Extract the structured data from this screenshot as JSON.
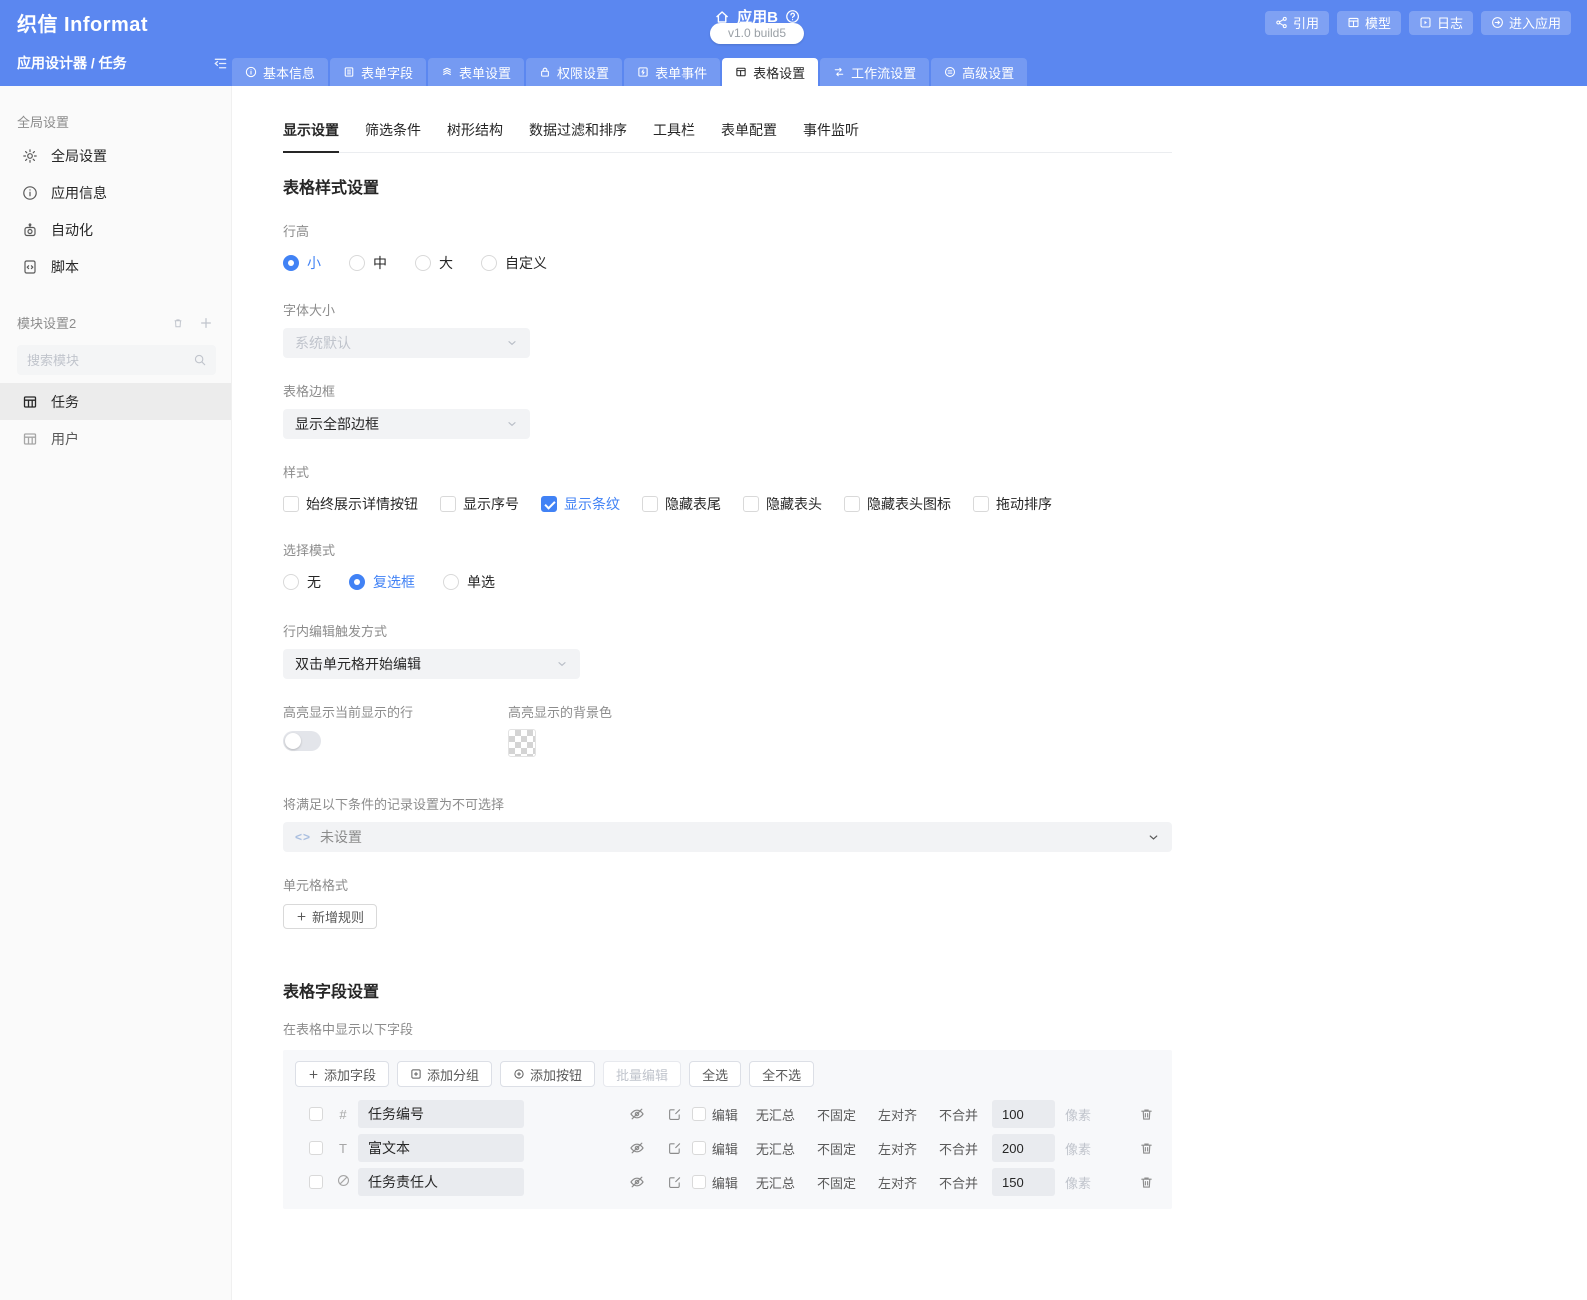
{
  "app": {
    "logo": "织信 Informat",
    "title": "应用B",
    "version": "v1.0 build5",
    "breadcrumb": "应用设计器 / 任务",
    "actions": [
      {
        "label": "引用"
      },
      {
        "label": "模型"
      },
      {
        "label": "日志"
      },
      {
        "label": "进入应用"
      }
    ]
  },
  "nav_tabs": [
    {
      "label": "基本信息"
    },
    {
      "label": "表单字段"
    },
    {
      "label": "表单设置"
    },
    {
      "label": "权限设置"
    },
    {
      "label": "表单事件"
    },
    {
      "label": "表格设置",
      "active": true
    },
    {
      "label": "工作流设置"
    },
    {
      "label": "高级设置"
    }
  ],
  "sidebar": {
    "global_section": "全局设置",
    "global_items": [
      {
        "label": "全局设置"
      },
      {
        "label": "应用信息"
      },
      {
        "label": "自动化"
      },
      {
        "label": "脚本"
      }
    ],
    "module_section": "模块设置2",
    "search_placeholder": "搜索模块",
    "modules": [
      {
        "label": "任务",
        "active": true
      },
      {
        "label": "用户",
        "active": false
      }
    ]
  },
  "subtabs": [
    {
      "label": "显示设置",
      "active": true
    },
    {
      "label": "筛选条件"
    },
    {
      "label": "树形结构"
    },
    {
      "label": "数据过滤和排序"
    },
    {
      "label": "工具栏"
    },
    {
      "label": "表单配置"
    },
    {
      "label": "事件监听"
    }
  ],
  "style": {
    "title": "表格样式设置",
    "row_height_label": "行高",
    "row_height_options": [
      {
        "label": "小"
      },
      {
        "label": "中"
      },
      {
        "label": "大"
      },
      {
        "label": "自定义"
      }
    ],
    "row_height_selected": "小",
    "font_size_label": "字体大小",
    "font_size_value": "系统默认",
    "border_label": "表格边框",
    "border_value": "显示全部边框",
    "style_label": "样式",
    "style_options": [
      {
        "label": "始终展示详情按钮"
      },
      {
        "label": "显示序号"
      },
      {
        "label": "显示条纹",
        "checked": true
      },
      {
        "label": "隐藏表尾"
      },
      {
        "label": "隐藏表头"
      },
      {
        "label": "隐藏表头图标"
      },
      {
        "label": "拖动排序"
      }
    ],
    "select_mode_label": "选择模式",
    "select_mode_options": [
      {
        "label": "无"
      },
      {
        "label": "复选框"
      },
      {
        "label": "单选"
      }
    ],
    "select_mode_selected": "复选框",
    "inline_edit_label": "行内编辑触发方式",
    "inline_edit_value": "双击单元格开始编辑",
    "highlight_row_label": "高亮显示当前显示的行",
    "highlight_row_enabled": false,
    "highlight_bg_label": "高亮显示的背景色",
    "disable_select_label": "将满足以下条件的记录设置为不可选择",
    "disable_select_value": "未设置",
    "cell_format_label": "单元格格式",
    "add_rule_label": "新增规则"
  },
  "fields": {
    "title": "表格字段设置",
    "subtitle": "在表格中显示以下字段",
    "toolbar": [
      {
        "label": "添加字段"
      },
      {
        "label": "添加分组"
      },
      {
        "label": "添加按钮"
      },
      {
        "label": "批量编辑",
        "disabled": true
      },
      {
        "label": "全选"
      },
      {
        "label": "全不选"
      }
    ],
    "row_labels": {
      "edit": "编辑",
      "summary": "无汇总",
      "fixed": "不固定",
      "align": "左对齐",
      "merge": "不合并",
      "unit": "像素"
    },
    "rows": [
      {
        "type": "number",
        "name": "任务编号",
        "width": "100"
      },
      {
        "type": "text",
        "name": "富文本",
        "width": "200"
      },
      {
        "type": "link",
        "name": "任务责任人",
        "width": "150"
      }
    ]
  },
  "colors": {
    "accent": "#4182f5",
    "header": "#5b87f0"
  }
}
